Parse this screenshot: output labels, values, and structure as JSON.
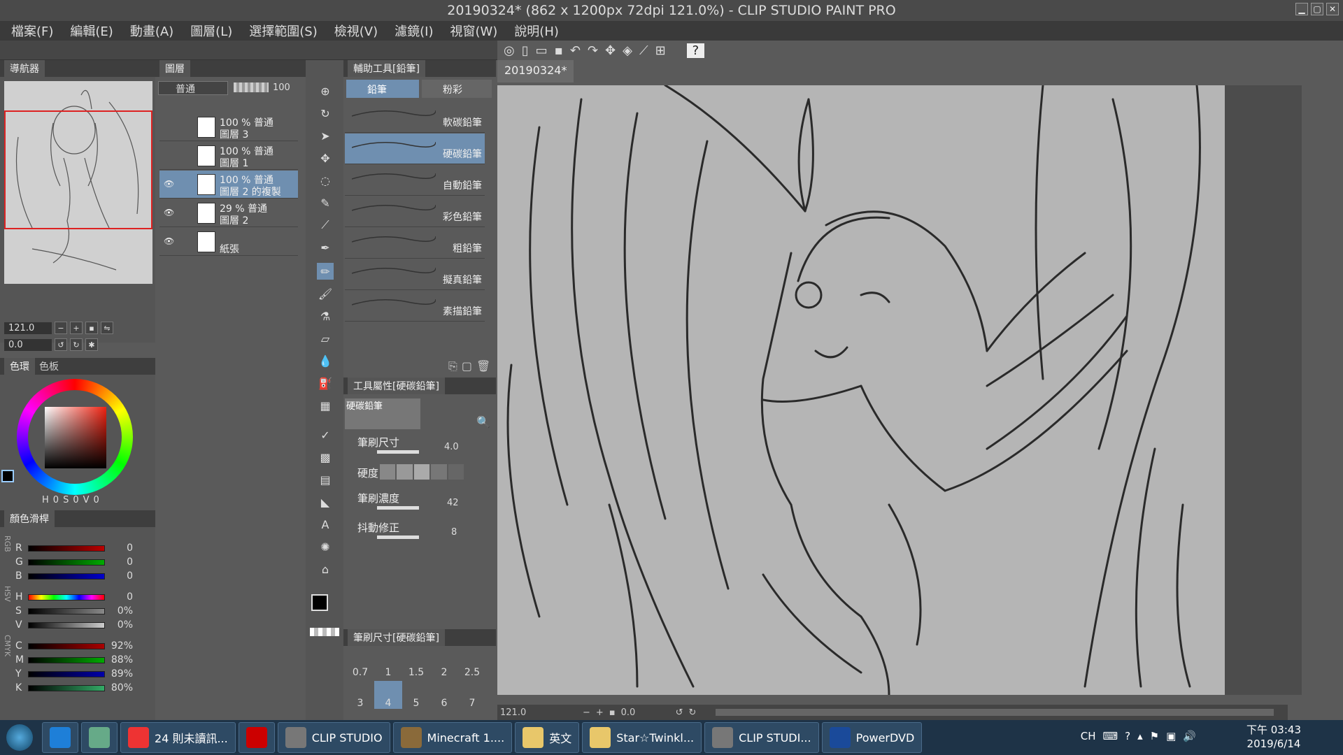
{
  "window": {
    "title": "20190324* (862 x 1200px 72dpi 121.0%)  - CLIP STUDIO PAINT PRO"
  },
  "menu": [
    "檔案(F)",
    "編輯(E)",
    "動畫(A)",
    "圖層(L)",
    "選擇範圍(S)",
    "檢視(V)",
    "濾鏡(I)",
    "視窗(W)",
    "說明(H)"
  ],
  "navigator": {
    "tab_label": "導航器",
    "zoom": "121.0",
    "rotation": "0.0"
  },
  "layers": {
    "tab_label": "圖層",
    "blend_mode": "普通",
    "opacity": "100",
    "rows": [
      {
        "line1": "100 % 普通",
        "line2": "圖層 3",
        "selected": false,
        "visible": false
      },
      {
        "line1": "100 % 普通",
        "line2": "圖層 1",
        "selected": false,
        "visible": false
      },
      {
        "line1": "100 % 普通",
        "line2": "圖層 2 的複製",
        "selected": true,
        "visible": true
      },
      {
        "line1": "29 % 普通",
        "line2": "圖層 2",
        "selected": false,
        "visible": true
      },
      {
        "line1": "",
        "line2": "紙張",
        "selected": false,
        "visible": true
      }
    ]
  },
  "color": {
    "wheel_tab": "色環",
    "palette_tab": "色板",
    "hsv_readout": [
      "H",
      "0",
      "S",
      "0",
      "V",
      "0"
    ],
    "slider_tab": "顏色滑桿",
    "sliders": [
      {
        "label": "R",
        "value": "0",
        "gradient": "#b00"
      },
      {
        "label": "G",
        "value": "0",
        "gradient": "#0a0"
      },
      {
        "label": "B",
        "value": "0",
        "gradient": "#00c"
      },
      {
        "label": "H",
        "value": "0",
        "gradient": "hue"
      },
      {
        "label": "S",
        "value": "0%",
        "gradient": "#888"
      },
      {
        "label": "V",
        "value": "0%",
        "gradient": "#ccc"
      },
      {
        "label": "C",
        "value": "92%",
        "gradient": "#a00"
      },
      {
        "label": "M",
        "value": "88%",
        "gradient": "#0a0"
      },
      {
        "label": "Y",
        "value": "89%",
        "gradient": "#00a"
      },
      {
        "label": "K",
        "value": "80%",
        "gradient": "#3a6"
      }
    ],
    "group_labels": [
      "RGB",
      "HSV",
      "CMYK"
    ]
  },
  "subtool": {
    "header": "輔助工具[鉛筆]",
    "tabs": [
      "鉛筆",
      "粉彩"
    ],
    "brushes": [
      "軟碳鉛筆",
      "硬碳鉛筆",
      "自動鉛筆",
      "彩色鉛筆",
      "粗鉛筆",
      "擬真鉛筆",
      "素描鉛筆"
    ],
    "selected_index": 1
  },
  "properties": {
    "header": "工具屬性[硬碳鉛筆]",
    "preview_label": "硬碳鉛筆",
    "brush_size_label": "筆刷尺寸",
    "brush_size": "4.0",
    "hardness_label": "硬度",
    "density_label": "筆刷濃度",
    "density": "42",
    "stabilization_label": "抖動修正",
    "stabilization": "8"
  },
  "brushsize": {
    "header": "筆刷尺寸[硬碳鉛筆]",
    "sizes": [
      "0.7",
      "1",
      "1.5",
      "2",
      "2.5",
      "3",
      "4",
      "5",
      "6",
      "7"
    ],
    "selected": "4"
  },
  "canvas": {
    "tab": "20190324*",
    "zoom": "121.0",
    "rotation": "0.0"
  },
  "taskbar": {
    "items": [
      {
        "label": "",
        "icon": "ie-icon",
        "color": "#1e7fd8"
      },
      {
        "label": "",
        "icon": "app-icon",
        "color": "#6a8"
      },
      {
        "label": "24 則未讀訊...",
        "icon": "chrome-icon",
        "color": "#e33"
      },
      {
        "label": "",
        "icon": "acrobat-icon",
        "color": "#c00"
      },
      {
        "label": "CLIP STUDIO",
        "icon": "clipstudio-icon",
        "color": "#777"
      },
      {
        "label": "Minecraft 1....",
        "icon": "minecraft-icon",
        "color": "#8a6a3a"
      },
      {
        "label": "英文",
        "icon": "folder-icon",
        "color": "#e8c76a"
      },
      {
        "label": "Star☆Twinkl...",
        "icon": "folder-icon",
        "color": "#e8c76a"
      },
      {
        "label": "CLIP STUDI...",
        "icon": "clipstudio-icon",
        "color": "#777"
      },
      {
        "label": "PowerDVD",
        "icon": "powerdvd-icon",
        "color": "#1a4a9a"
      }
    ],
    "ime": "CH",
    "time": "下午 03:43",
    "date": "2019/6/14"
  }
}
